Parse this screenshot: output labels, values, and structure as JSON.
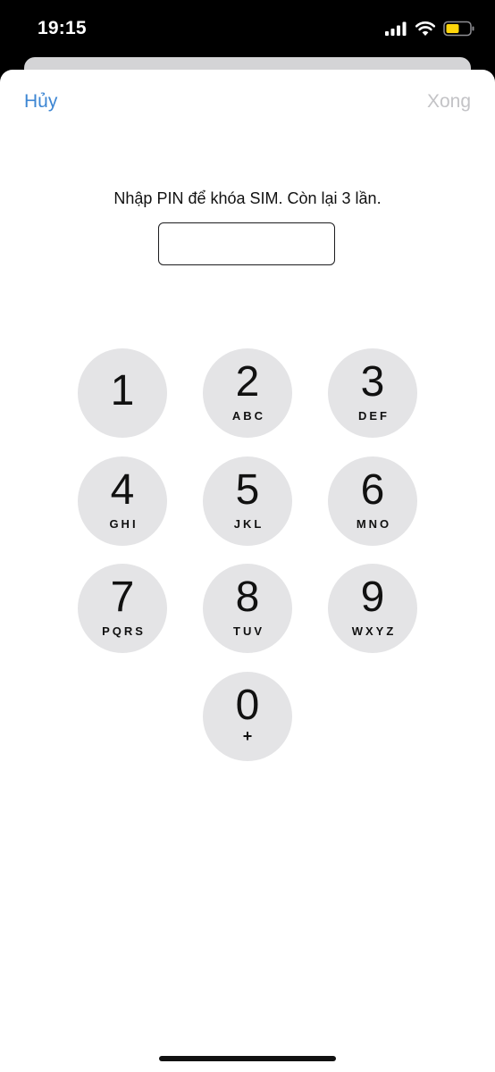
{
  "status_bar": {
    "time": "19:15",
    "icons": [
      "cellular-signal-icon",
      "wifi-icon",
      "battery-icon"
    ],
    "battery_color": "#ffd60a"
  },
  "nav": {
    "cancel_label": "Hủy",
    "done_label": "Xong",
    "cancel_color": "#3d86d3",
    "done_color": "#c3c3c6"
  },
  "prompt": "Nhập PIN để khóa SIM. Còn lại 3 lần.",
  "pin_input": {
    "value": "",
    "placeholder": ""
  },
  "keypad": [
    {
      "digit": "1",
      "letters": ""
    },
    {
      "digit": "2",
      "letters": "ABC"
    },
    {
      "digit": "3",
      "letters": "DEF"
    },
    {
      "digit": "4",
      "letters": "GHI"
    },
    {
      "digit": "5",
      "letters": "JKL"
    },
    {
      "digit": "6",
      "letters": "MNO"
    },
    {
      "digit": "7",
      "letters": "PQRS"
    },
    {
      "digit": "8",
      "letters": "TUV"
    },
    {
      "digit": "9",
      "letters": "WXYZ"
    },
    {
      "digit": "0",
      "letters": "+"
    }
  ]
}
